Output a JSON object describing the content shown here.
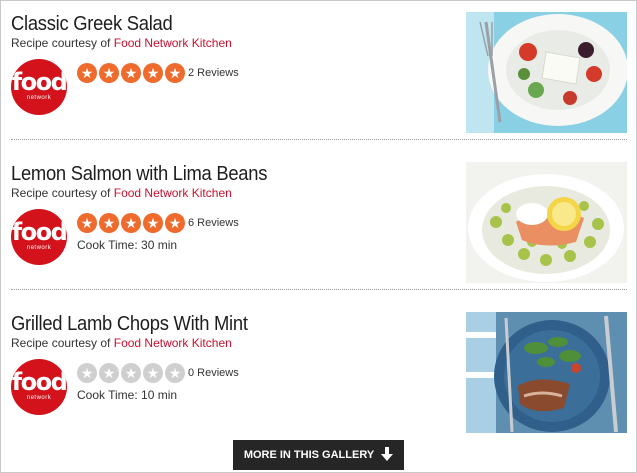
{
  "gallery": {
    "more_label": "MORE IN THIS GALLERY",
    "recipes": [
      {
        "title": "Classic Greek Salad",
        "courtesy_prefix": "Recipe courtesy of",
        "source": "Food Network Kitchen",
        "rating": 5,
        "reviews": "2 Reviews",
        "cook_time": "",
        "logo": {
          "word": "food",
          "sub": "network"
        }
      },
      {
        "title": "Lemon Salmon with Lima Beans",
        "courtesy_prefix": "Recipe courtesy of",
        "source": "Food Network Kitchen",
        "rating": 5,
        "reviews": "6 Reviews",
        "cook_time": "Cook Time:  30 min",
        "logo": {
          "word": "food",
          "sub": "network"
        }
      },
      {
        "title": "Grilled Lamb Chops With Mint",
        "courtesy_prefix": "Recipe courtesy of",
        "source": "Food Network Kitchen",
        "rating": 0,
        "reviews": "0 Reviews",
        "cook_time": "Cook Time:  10 min",
        "logo": {
          "word": "food",
          "sub": "network"
        }
      }
    ]
  },
  "colors": {
    "brand_red": "#d3121c",
    "link_red": "#c8102e",
    "star_on": "#ee6b2d",
    "star_off": "#cfcfcf",
    "button_bg": "#262626"
  }
}
